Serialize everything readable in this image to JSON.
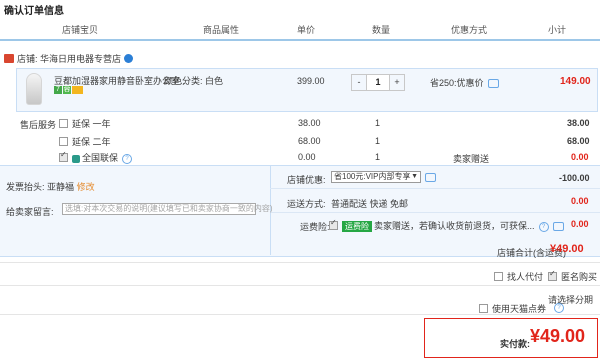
{
  "page_title": "确认订单信息",
  "columns": [
    "店铺宝贝",
    "商品属性",
    "单价",
    "数量",
    "优惠方式",
    "小计"
  ],
  "shop": {
    "label": "店铺: 华海日用电器专营店"
  },
  "item": {
    "title": "豆都加湿器家用静音卧室办公室...",
    "attribute": "颜色分类: 白色",
    "badges": [
      "7",
      "蓉"
    ],
    "unit_price": "399.00",
    "quantity": "1",
    "minus": "-",
    "plus": "+",
    "discount": "省250:优惠价",
    "subtotal": "149.00"
  },
  "after_sales": {
    "label": "售后服务",
    "rows": [
      {
        "name": "延保 一年",
        "price": "38.00",
        "qty": "1",
        "note": "",
        "subtotal": "38.00"
      },
      {
        "name": "延保 二年",
        "price": "68.00",
        "qty": "1",
        "note": "",
        "subtotal": "68.00"
      },
      {
        "name": "全国联保",
        "price": "0.00",
        "qty": "1",
        "note": "卖家赠送",
        "subtotal": "0.00"
      }
    ]
  },
  "invoice": {
    "label": "发票抬头:",
    "value": "亚静福",
    "edit": "修改"
  },
  "message": {
    "label": "给卖家留言:",
    "placeholder": "选填:对本次交易的说明(建议填写已和卖家协商一致的内容)"
  },
  "store_coupon": {
    "label": "店铺优惠:",
    "selected": "省100元:VIP内部专享",
    "amount": "-100.00"
  },
  "shipping": {
    "label": "运送方式:",
    "value": "普通配送 快递 免邮",
    "amount": "0.00"
  },
  "freight_insurance": {
    "label": "运费险:",
    "tag": "运费险",
    "text": "卖家赠送，若确认收货前退货，可获保...",
    "amount": "0.00"
  },
  "store_total": {
    "label": "店铺合计(含运费)",
    "value": "¥49.00"
  },
  "options": {
    "proxy": "找人代付",
    "anonymous": "匿名购买",
    "installment": "请选择分期",
    "tmall_coupon": "使用天猫点券"
  },
  "pay": {
    "label": "实付款:",
    "value": "¥49.00"
  }
}
